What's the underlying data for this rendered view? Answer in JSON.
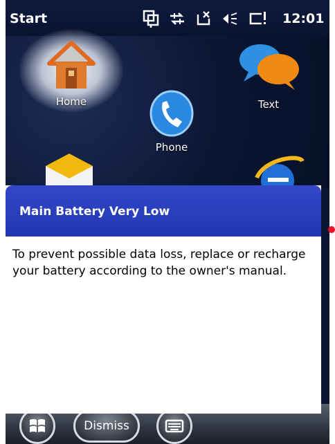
{
  "status_bar": {
    "title": "Start",
    "time": "12:01",
    "icons": [
      "messaging-icon",
      "network-sync-icon",
      "no-phone-signal-icon",
      "volume-icon",
      "battery-critical-icon"
    ]
  },
  "home_tiles": [
    {
      "label": "Home",
      "icon": "house-icon"
    },
    {
      "label": "Text",
      "icon": "chat-bubbles-icon"
    },
    {
      "label": "Phone",
      "icon": "phone-icon"
    },
    {
      "label": "",
      "icon": "mail-icon"
    },
    {
      "label": "",
      "icon": "internet-explorer-icon"
    }
  ],
  "dialog": {
    "title": "Main Battery Very Low",
    "message": "To prevent possible data loss, replace or recharge your battery according to the owner's manual."
  },
  "bottom_bar": {
    "dismiss_label": "Dismiss",
    "start_icon": "windows-logo-icon",
    "keyboard_icon": "keyboard-icon"
  },
  "colors": {
    "dialog_header": "#2a3dbb",
    "background": "#0b1430",
    "marker": "#e8112b"
  }
}
